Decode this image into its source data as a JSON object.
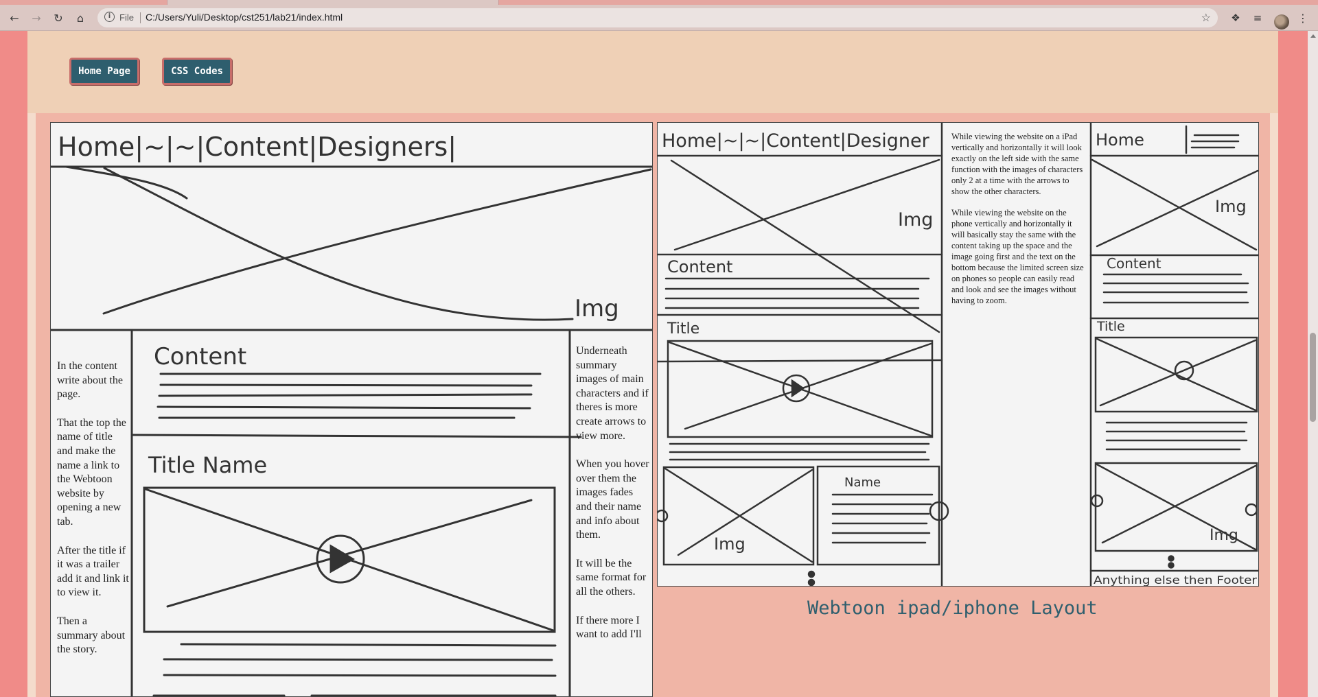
{
  "browser": {
    "back_icon": "arrow-left-icon",
    "forward_icon": "arrow-right-icon",
    "reload_icon": "reload-icon",
    "home_icon": "home-icon",
    "site_info_icon": "info-icon",
    "protocol_label": "File",
    "url": "C:/Users/Yuli/Desktop/cst251/lab21/index.html",
    "bookmark_icon": "star-icon",
    "extensions_icon": "puzzle-icon",
    "media_icon": "playlist-icon",
    "menu_icon": "kebab-menu-icon"
  },
  "nav": {
    "home_label": "Home Page",
    "css_label": "CSS Codes"
  },
  "desktop_sketch": {
    "nav_text": "Home|~|~|Content|Designers|",
    "img_label": "Img",
    "content_label": "Content",
    "title_label": "Title Name",
    "left_notes": [
      "In the content write about the page.",
      "That the top the name of title and make the name a link to the Webtoon website by opening a new tab.",
      "After the title if it was a trailer add it and link it to view it.",
      "Then a summary about the story."
    ],
    "right_notes": [
      "Underneath summary images of main characters and if theres is more create arrows to view more.",
      "When you hover over them the images fades and their name and info about them.",
      "It will be the same format for all the others.",
      "If there more I want to add I'll"
    ]
  },
  "mobile_sketch": {
    "ipad_nav_text": "Home|~|~|Content|Designer",
    "img_label": "Img",
    "img_label_2": "Img",
    "content_label": "Content",
    "title_label": "Title",
    "name_label": "Name",
    "phone_nav_text": "Home",
    "phone_img_label": "Img",
    "phone_content_label": "Content",
    "phone_title_label": "Title",
    "phone_img_label_2": "Img",
    "phone_footer_text": "Anything else then Footer",
    "notes": [
      "While viewing the website on a iPad vertically and horizontally it will look exactly on the left side with the same function with the images of characters only 2 at a time with the arrows to show the other characters.",
      "While viewing the website on the phone vertically and horizontally it will basically stay the same with the content taking up the space and the image going first and the text on the bottom because the limited screen size on phones so people can easily read and look and see the images without having to zoom."
    ]
  },
  "caption": "Webtoon ipad/iphone Layout",
  "colors": {
    "page_bg": "#f08b88",
    "header_bg": "#efd0b6",
    "body_bg": "#f0b5a6",
    "button_bg": "#2e5e6e",
    "button_border": "#c86d6a",
    "caption_color": "#2f5f6e"
  }
}
